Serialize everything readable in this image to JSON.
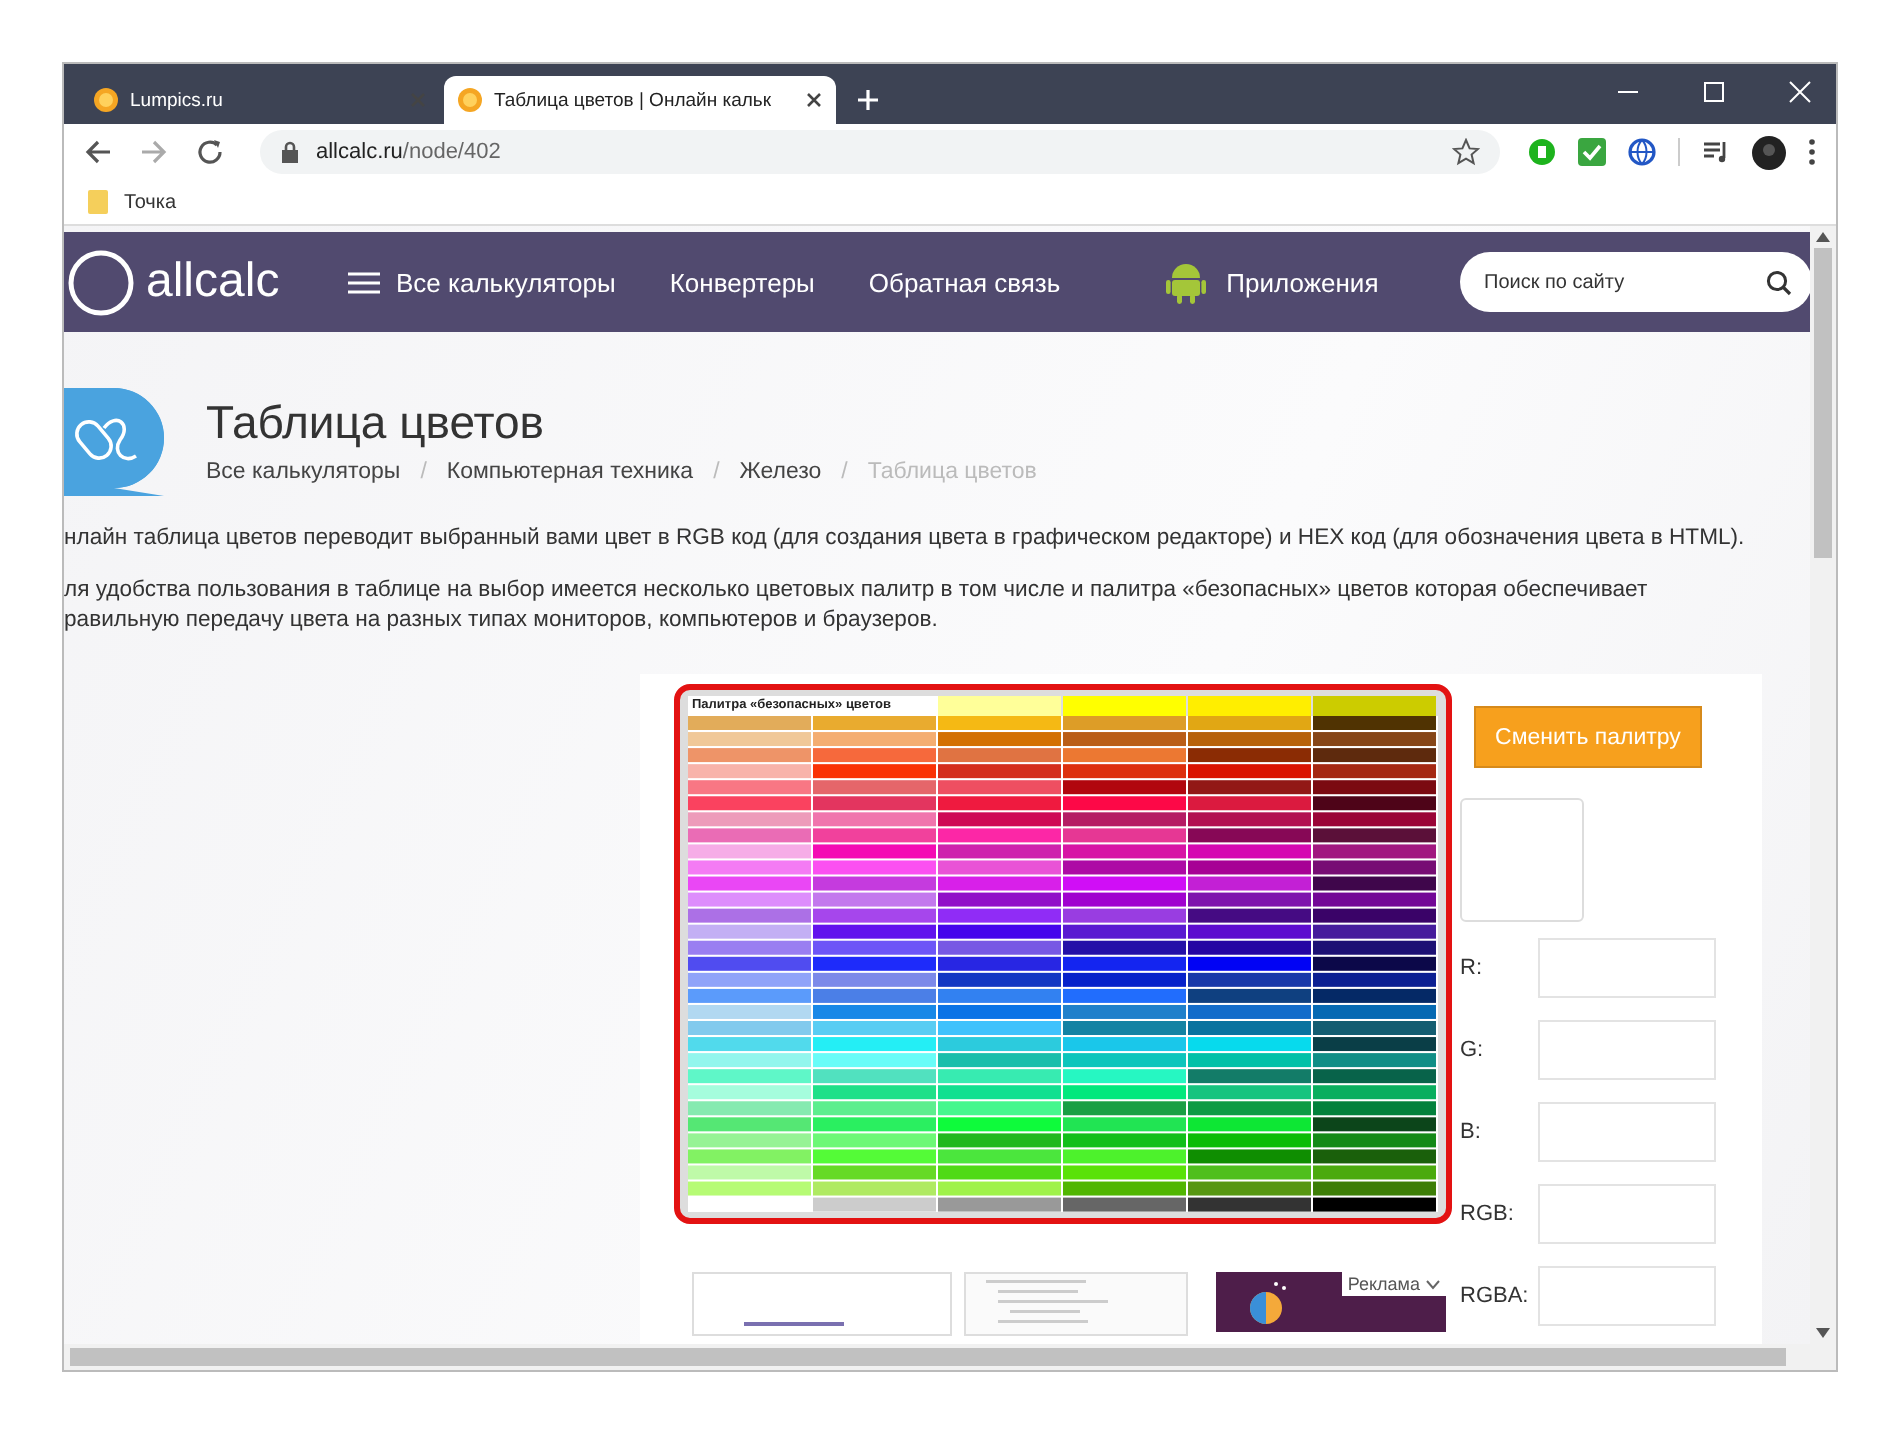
{
  "browser": {
    "tabs": [
      {
        "title": "Lumpics.ru",
        "selected": false
      },
      {
        "title": "Таблица цветов | Онлайн кальк",
        "selected": true
      }
    ],
    "address": {
      "host": "allcalc.ru",
      "path": "/node/402"
    },
    "bookmarks": [
      "Точка"
    ]
  },
  "site_header": {
    "logo": "allcalc",
    "nav": [
      {
        "label": "Все калькуляторы",
        "kind": "menu"
      },
      {
        "label": "Конвертеры",
        "kind": "link"
      },
      {
        "label": "Обратная связь",
        "kind": "link"
      },
      {
        "label": "Приложения",
        "kind": "app"
      }
    ],
    "search": {
      "placeholder": "Поиск по сайту"
    }
  },
  "page": {
    "title": "Таблица цветов",
    "breadcrumbs": [
      {
        "label": "Все калькуляторы",
        "current": false
      },
      {
        "label": "Компьютерная техника",
        "current": false
      },
      {
        "label": "Железо",
        "current": false
      },
      {
        "label": "Таблица цветов",
        "current": true
      }
    ],
    "separators": [
      "/",
      "/",
      "/"
    ],
    "paragraphs": [
      "нлайн таблица цветов переводит выбранный вами цвет в RGB код (для создания цвета в графическом редакторе) и HEX код (для обозначения цвета в HTML).",
      "ля удобства пользования в таблице на выбор имеется несколько цветовых палитр в том числе и палитра «безопасных» цветов которая обеспечивает",
      "равильную передачу цвета на разных типах мониторов, компьютеров и браузеров."
    ]
  },
  "palette": {
    "title": "Палитра «безопасных» цветов",
    "highlighted": true
  },
  "controls": {
    "button": "Сменить палитру",
    "fields": [
      {
        "label": "R:"
      },
      {
        "label": "G:"
      },
      {
        "label": "B:"
      },
      {
        "label": "RGB:"
      },
      {
        "label": "RGBA:"
      }
    ]
  },
  "ads": {
    "label": "Реклама"
  }
}
